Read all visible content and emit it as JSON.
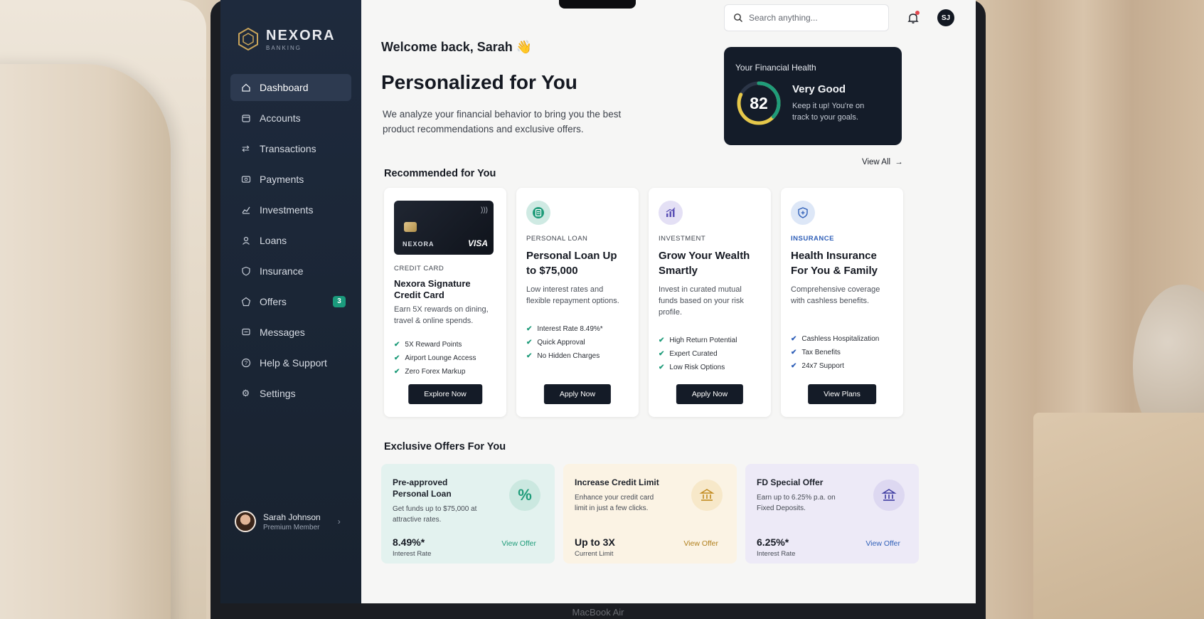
{
  "device": {
    "label": "MacBook Air"
  },
  "brand": {
    "name": "NEXORA",
    "subtitle": "BANKING"
  },
  "sidebar": {
    "items": [
      {
        "label": "Dashboard",
        "icon": "home-icon",
        "active": true
      },
      {
        "label": "Accounts",
        "icon": "wallet-icon"
      },
      {
        "label": "Transactions",
        "icon": "transfer-icon"
      },
      {
        "label": "Payments",
        "icon": "payment-icon"
      },
      {
        "label": "Investments",
        "icon": "chart-icon"
      },
      {
        "label": "Loans",
        "icon": "loan-icon"
      },
      {
        "label": "Insurance",
        "icon": "shield-icon"
      },
      {
        "label": "Offers",
        "icon": "tag-icon",
        "badge": "3"
      },
      {
        "label": "Messages",
        "icon": "message-icon"
      },
      {
        "label": "Help & Support",
        "icon": "help-icon"
      },
      {
        "label": "Settings",
        "icon": "gear-icon"
      }
    ],
    "profile": {
      "name": "Sarah Johnson",
      "role": "Premium Member"
    }
  },
  "topbar": {
    "search_placeholder": "Search anything...",
    "avatar_initials": "SJ"
  },
  "hero": {
    "welcome": "Welcome back, Sarah 👋",
    "title": "Personalized for You",
    "subtitle": "We analyze your financial behavior to bring you the best product recommendations and exclusive offers."
  },
  "health": {
    "title": "Your Financial Health",
    "score": "82",
    "score_fraction": 0.82,
    "status": "Very Good",
    "description": "Keep it up! You're on track to your goals."
  },
  "recommended": {
    "title": "Recommended for You",
    "view_all": "View All",
    "cards": [
      {
        "category": "CREDIT CARD",
        "title": "Nexora Signature Credit Card",
        "description": "Earn 5X rewards on dining, travel & online spends.",
        "features": [
          "5X Reward Points",
          "Airport Lounge Access",
          "Zero Forex Markup"
        ],
        "button": "Explore Now",
        "card_brand": "NEXORA",
        "card_network": "VISA"
      },
      {
        "category": "PERSONAL LOAN",
        "title": "Personal Loan Up to $75,000",
        "description": "Low interest rates and flexible repayment options.",
        "features": [
          "Interest Rate 8.49%*",
          "Quick Approval",
          "No Hidden Charges"
        ],
        "button": "Apply Now"
      },
      {
        "category": "INVESTMENT",
        "title": "Grow Your Wealth Smartly",
        "description": "Invest in curated mutual funds based on your risk profile.",
        "features": [
          "High Return Potential",
          "Expert Curated",
          "Low Risk Options"
        ],
        "button": "Apply Now"
      },
      {
        "category": "INSURANCE",
        "title": "Health Insurance For You & Family",
        "description": "Comprehensive coverage with cashless benefits.",
        "features": [
          "Cashless Hospitalization",
          "Tax Benefits",
          "24x7 Support"
        ],
        "button": "View Plans"
      }
    ]
  },
  "offers": {
    "title": "Exclusive Offers For You",
    "items": [
      {
        "title": "Pre-approved Personal Loan",
        "description": "Get funds up to $75,000 at attractive rates.",
        "value": "8.49%*",
        "value_label": "Interest Rate",
        "link": "View Offer",
        "icon": "percent-icon"
      },
      {
        "title": "Increase Credit Limit",
        "description": "Enhance your credit card limit in just a few clicks.",
        "value": "Up to 3X",
        "value_label": "Current Limit",
        "link": "View Offer",
        "icon": "bank-icon"
      },
      {
        "title": "FD Special Offer",
        "description": "Earn up to 6.25% p.a. on Fixed Deposits.",
        "value": "6.25%*",
        "value_label": "Interest Rate",
        "link": "View Offer",
        "icon": "bank-building-icon"
      }
    ]
  },
  "colors": {
    "sidebar_bg": "#1e2a3d",
    "dark_card": "#141c29",
    "accent_teal": "#1f9c7a",
    "accent_yellow": "#e6c84a",
    "insurance_blue": "#2f5fb8",
    "offer_teal_bg": "#e3f2ef",
    "offer_amber_bg": "#fbf3e4",
    "offer_lilac_bg": "#edeaf7"
  }
}
